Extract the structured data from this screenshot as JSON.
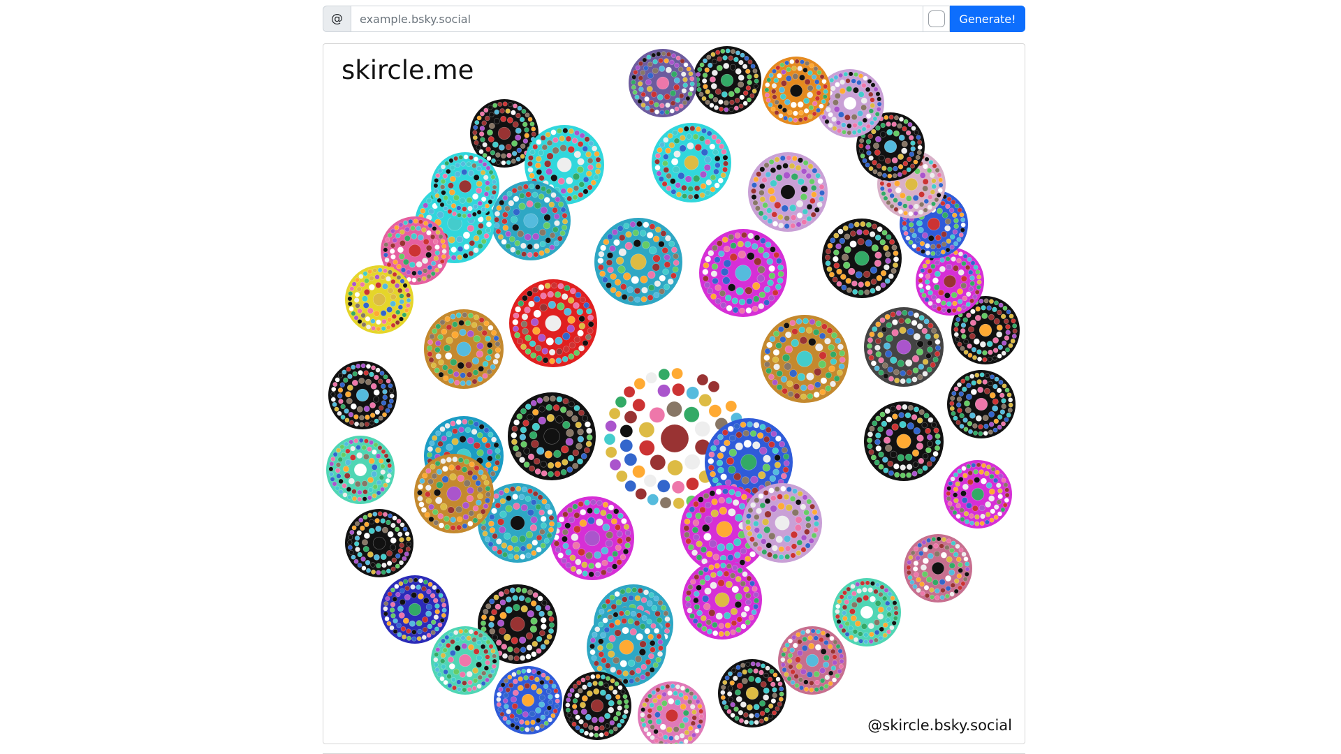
{
  "form": {
    "at_symbol": "@",
    "handle_placeholder": "example.bsky.social",
    "handle_value": "",
    "generate_label": "Generate!"
  },
  "card": {
    "brand": "skircle.me",
    "credit": "@skircle.bsky.social"
  },
  "colors": {
    "accent": "#0d6efd",
    "border": "#d6d6d6",
    "cluster_palette": [
      "#111111",
      "#d62fd6",
      "#2ea7c4",
      "#31d7dc",
      "#e02020",
      "#e58a1f",
      "#e5d52a",
      "#2f5bd9",
      "#2b2bb8",
      "#4fd6b4",
      "#e079b8",
      "#c9a0d6",
      "#c76f8f",
      "#d8b0c8",
      "#6c5b9e",
      "#c4892e",
      "#e65fa0",
      "#1b9cc4"
    ]
  },
  "clusters": [
    {
      "color": "#e9e9f1",
      "role": "center"
    },
    {
      "color": "#e02020"
    },
    {
      "color": "#2ea7c4"
    },
    {
      "color": "#d62fd6"
    },
    {
      "color": "#c4892e"
    },
    {
      "color": "#111111"
    },
    {
      "color": "#2f5bd9"
    },
    {
      "color": "#d62fd6"
    },
    {
      "color": "#d62fd6"
    },
    {
      "color": "#111111"
    },
    {
      "color": "#31d7dc"
    },
    {
      "color": "#31d7dc"
    },
    {
      "color": "#2ea7c4"
    },
    {
      "color": "#31d7dc"
    },
    {
      "color": "#c9a0d6"
    },
    {
      "color": "#111111"
    },
    {
      "color": "#444444"
    },
    {
      "color": "#111111"
    },
    {
      "color": "#111111"
    },
    {
      "color": "#c9a0d6"
    },
    {
      "color": "#d62fd6"
    },
    {
      "color": "#c4892e"
    },
    {
      "color": "#1b9cc4"
    },
    {
      "color": "#2ea7c4"
    },
    {
      "color": "#2ea7c4"
    },
    {
      "color": "#c4892e"
    },
    {
      "color": "#2ea7c4"
    },
    {
      "color": "#31d7dc"
    },
    {
      "color": "#e65fa0"
    },
    {
      "color": "#e5d52a"
    },
    {
      "color": "#111111"
    },
    {
      "color": "#4fd6b4"
    },
    {
      "color": "#111111"
    },
    {
      "color": "#2b2bb8"
    },
    {
      "color": "#4fd6b4"
    },
    {
      "color": "#2f5bd9"
    },
    {
      "color": "#111111"
    },
    {
      "color": "#e079b8"
    },
    {
      "color": "#111111"
    },
    {
      "color": "#c76f8f"
    },
    {
      "color": "#4fd6b4"
    },
    {
      "color": "#c76f8f"
    },
    {
      "color": "#d62fd6"
    },
    {
      "color": "#111111"
    },
    {
      "color": "#111111"
    },
    {
      "color": "#d62fd6"
    },
    {
      "color": "#2f5bd9"
    },
    {
      "color": "#d8b0c8"
    },
    {
      "color": "#111111"
    },
    {
      "color": "#c9a0d6"
    },
    {
      "color": "#e58a1f"
    },
    {
      "color": "#111111"
    },
    {
      "color": "#6c5b9e"
    }
  ]
}
